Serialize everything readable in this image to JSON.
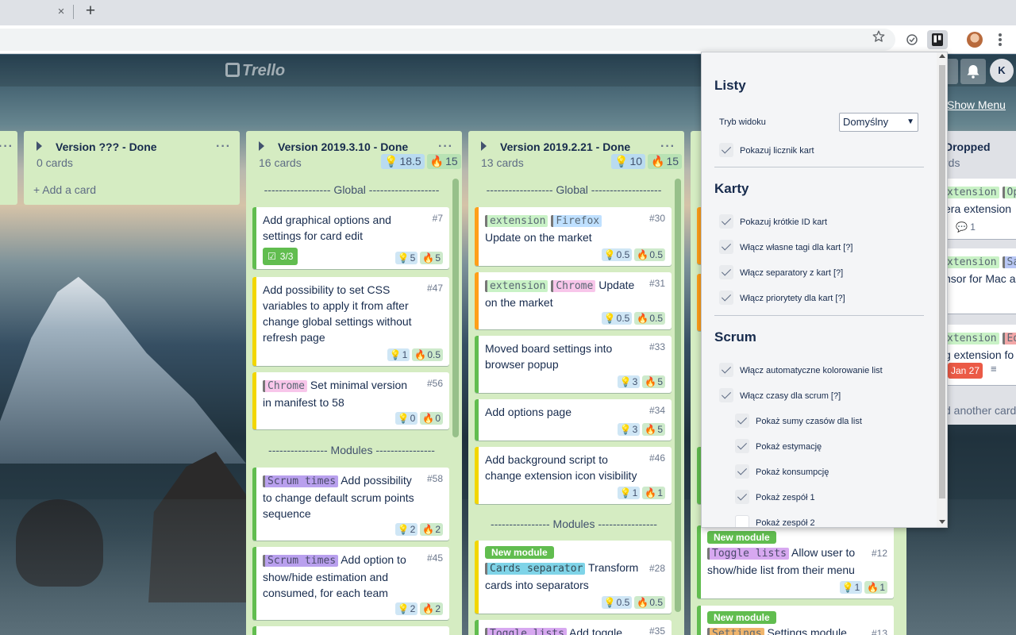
{
  "browser": {
    "tab_close": "×",
    "new_tab": "+"
  },
  "board": {
    "logo": "Trello",
    "avatar_initial": "K",
    "show_menu": "Show Menu"
  },
  "lists": {
    "far_left": {},
    "v_unknown": {
      "title": "Version ??? - Done",
      "count": "0 cards",
      "add_card": "+ Add a card"
    },
    "v2019_3_10": {
      "title": "Version 2019.3.10 - Done",
      "count": "16 cards",
      "est_total": "18.5",
      "cons_total": "15",
      "sep_global": "------------------ Global -------------------",
      "sep_modules": "---------------- Modules ----------------",
      "cards": [
        {
          "title": "Add graphical options and settings for card edit",
          "id": "#7",
          "checklist": "3/3",
          "est": "5",
          "cons": "5"
        },
        {
          "title": "Add possibility to set CSS variables to apply it from after change global settings without refresh page",
          "id": "#47",
          "est": "1",
          "cons": "0.5"
        },
        {
          "tag": "Chrome",
          "title": "Set minimal version in manifest to 58",
          "id": "#56",
          "est": "0",
          "cons": "0"
        },
        {
          "tag": "Scrum times",
          "title": "Add possibility to change default scrum points sequence",
          "id": "#58",
          "est": "2",
          "cons": "2"
        },
        {
          "tag": "Scrum times",
          "title": "Add option to show/hide estimation and consumed, for each team",
          "id": "#45",
          "est": "2",
          "cons": "2"
        }
      ]
    },
    "v2019_2_21": {
      "title": "Version 2019.2.21 - Done",
      "count": "13 cards",
      "est_total": "10",
      "cons_total": "15",
      "sep_global": "------------------ Global -------------------",
      "sep_modules": "---------------- Modules ----------------",
      "cards": [
        {
          "tag1": "extension",
          "tag2": "Firefox",
          "title": "Update on the market",
          "id": "#30",
          "est": "0.5",
          "cons": "0.5"
        },
        {
          "tag1": "extension",
          "tag2": "Chrome",
          "title": "Update on the market",
          "id": "#31",
          "est": "0.5",
          "cons": "0.5"
        },
        {
          "title": "Moved board settings into browser popup",
          "id": "#33",
          "est": "3",
          "cons": "5"
        },
        {
          "title": "Add options page",
          "id": "#34",
          "est": "3",
          "cons": "5"
        },
        {
          "title": "Add background script to change extension icon visibility",
          "id": "#46",
          "est": "1",
          "cons": "1"
        },
        {
          "label": "New module",
          "tag": "Cards separator",
          "title": "Transform cards into separators",
          "id": "#28",
          "est": "0.5",
          "cons": "0.5"
        },
        {
          "tag": "Toggle lists",
          "title": "Add toggle",
          "id": "#35"
        }
      ]
    },
    "v_hidden": {
      "cards": [
        {
          "label": "New module",
          "tag": "Toggle lists",
          "title": "Allow user to show/hide list from their menu",
          "id": "#12",
          "est": "1",
          "cons": "1"
        },
        {
          "label": "New module",
          "tag": "Settings",
          "title": "Settings module, to",
          "id": "#13"
        }
      ]
    },
    "dropped": {
      "title": "Dropped",
      "count": "rds",
      "cards": [
        {
          "tag1": "xtension",
          "tag2": "Op",
          "title": "era extension",
          "comments": "1"
        },
        {
          "tag1": "xtension",
          "tag2": "Sa",
          "title": "nsor for Mac a ensions"
        },
        {
          "tag1": "xtension",
          "tag2": "Ed",
          "title": "g extension fo",
          "date": "Jan 27"
        }
      ],
      "add_another": "d another card"
    }
  },
  "popup": {
    "sec_lists": "Listy",
    "view_mode_label": "Tryb widoku",
    "view_mode_value": "Domyślny",
    "show_card_counter": "Pokazuj licznik kart",
    "sec_cards": "Karty",
    "show_short_id": "Pokazuj krótkie ID kart",
    "enable_tags": "Włącz własne tagi dla kart [?]",
    "enable_separators": "Włącz separatory z kart [?]",
    "enable_priorities": "Włącz priorytety dla kart [?]",
    "sec_scrum": "Scrum",
    "enable_auto_coloring": "Włącz automatyczne kolorowanie list",
    "enable_scrum_times": "Włącz czasy dla scrum [?]",
    "show_sums": "Pokaż sumy czasów dla list",
    "show_estimation": "Pokaż estymację",
    "show_consumption": "Pokaż konsumpcję",
    "show_team1": "Pokaż zespół 1",
    "show_team2": "Pokaż zespół 2"
  },
  "colors": {
    "list_bg": "#d5ecc2",
    "accent_green": "#61bd4f",
    "accent_yellow": "#f2d600",
    "accent_orange": "#ff9f1a"
  }
}
